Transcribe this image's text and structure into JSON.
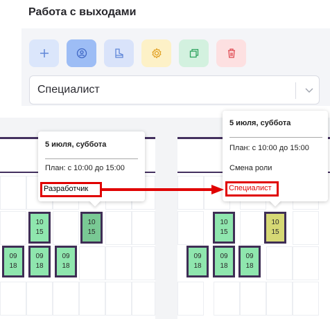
{
  "page": {
    "title": "Работа с выходами"
  },
  "toolbar": {
    "buttons": [
      {
        "icon": "plus-icon",
        "bg": "#dbe6fb",
        "color": "#5f86d8"
      },
      {
        "icon": "people-icon",
        "bg": "#9dbdf5",
        "color": "#3f67c4"
      },
      {
        "icon": "boot-icon",
        "bg": "#d9e3fa",
        "color": "#5f86d8"
      },
      {
        "icon": "gear-icon",
        "bg": "#fdf1c7",
        "color": "#e09d1c"
      },
      {
        "icon": "copy-icon",
        "bg": "#d3f1df",
        "color": "#2da35e"
      },
      {
        "icon": "trash-icon",
        "bg": "#fde0e1",
        "color": "#e04a52"
      }
    ]
  },
  "role_select": {
    "value": "Специалист"
  },
  "popover_left": {
    "date": "5 июля, суббота",
    "plan": "План: с 10:00 до 15:00",
    "role": "Разработчик"
  },
  "popover_right": {
    "date": "5 июля, суббота",
    "plan": "План: с 10:00 до 15:00",
    "action": "Смена роли",
    "role": "Специалист"
  },
  "shifts_left": [
    {
      "start": "10",
      "end": "15",
      "style": "green"
    },
    {
      "start": "10",
      "end": "15",
      "style": "darkgreen"
    },
    {
      "start": "09",
      "end": "18",
      "style": "green"
    },
    {
      "start": "09",
      "end": "18",
      "style": "green"
    },
    {
      "start": "09",
      "end": "18",
      "style": "green"
    }
  ],
  "shifts_right": [
    {
      "start": "10",
      "end": "15",
      "style": "green"
    },
    {
      "start": "10",
      "end": "15",
      "style": "yellow"
    },
    {
      "start": "09",
      "end": "18",
      "style": "green"
    },
    {
      "start": "09",
      "end": "18",
      "style": "green"
    },
    {
      "start": "09",
      "end": "18",
      "style": "green"
    }
  ],
  "colors": {
    "accent_red": "#e00000",
    "shift_border": "#3f2e55",
    "shift_green": "#8fe6ae",
    "shift_yellow": "#d6d875"
  }
}
